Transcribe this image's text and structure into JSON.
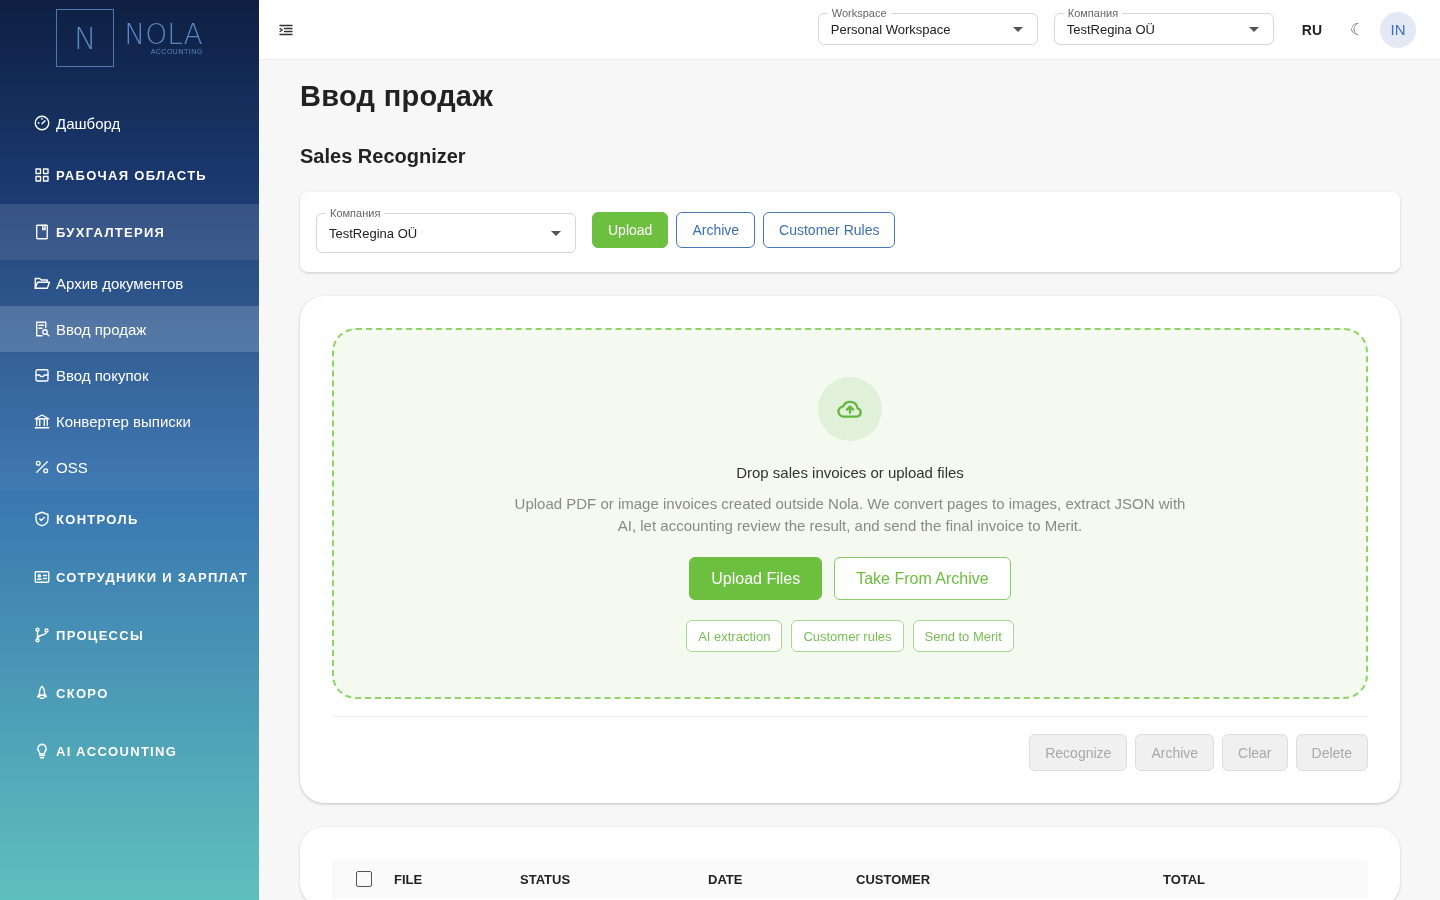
{
  "sidebar": {
    "logo": {
      "mark": "N",
      "name": "NOLA",
      "tagline": "ACCOUNTING"
    },
    "items": [
      {
        "kind": "link",
        "label": "Дашборд",
        "selected": false
      },
      {
        "kind": "section",
        "label": "РАБОЧАЯ ОБЛАСТЬ",
        "expanded": false
      },
      {
        "kind": "section",
        "label": "БУХГАЛТЕРИЯ",
        "expanded": true,
        "children": [
          {
            "label": "Архив документов",
            "selected": false
          },
          {
            "label": "Ввод продаж",
            "selected": true
          },
          {
            "label": "Ввод покупок",
            "selected": false
          },
          {
            "label": "Конвертер выписки",
            "selected": false
          },
          {
            "label": "OSS",
            "selected": false
          }
        ]
      },
      {
        "kind": "section",
        "label": "КОНТРОЛЬ",
        "expanded": false
      },
      {
        "kind": "section",
        "label": "СОТРУДНИКИ И ЗАРПЛАТ",
        "expanded": false
      },
      {
        "kind": "section",
        "label": "ПРОЦЕССЫ",
        "expanded": false
      },
      {
        "kind": "section",
        "label": "СКОРО",
        "expanded": false
      },
      {
        "kind": "section",
        "label": "AI ACCOUNTING",
        "expanded": false
      }
    ]
  },
  "topbar": {
    "workspace": {
      "label": "Workspace",
      "value": "Personal Workspace"
    },
    "company": {
      "label": "Компания",
      "value": "TestRegina OÜ"
    },
    "language": "RU",
    "theme_toggle": "☾",
    "avatar": "IN"
  },
  "page": {
    "title": "Ввод продаж",
    "subtitle": "Sales Recognizer",
    "toolbar": {
      "company": {
        "label": "Компания",
        "value": "TestRegina OÜ"
      },
      "buttons": [
        {
          "label": "Upload",
          "kind": "primary"
        },
        {
          "label": "Archive",
          "kind": "outline"
        },
        {
          "label": "Customer Rules",
          "kind": "outline"
        }
      ]
    },
    "dropzone": {
      "heading": "Drop sales invoices or upload files",
      "description": "Upload PDF or image invoices created outside Nola. We convert pages to images, extract JSON with AI, let accounting review the result, and send the final invoice to Merit.",
      "actions": [
        {
          "label": "Upload Files",
          "kind": "primary"
        },
        {
          "label": "Take From Archive",
          "kind": "outline"
        }
      ],
      "features": [
        "AI extraction",
        "Customer rules",
        "Send to Merit"
      ]
    },
    "bulk_actions": [
      {
        "label": "Recognize",
        "disabled": true
      },
      {
        "label": "Archive",
        "disabled": true
      },
      {
        "label": "Clear",
        "disabled": true
      },
      {
        "label": "Delete",
        "disabled": true
      }
    ],
    "table": {
      "select_all": {
        "checked": false
      },
      "columns": [
        "FILE",
        "STATUS",
        "DATE",
        "CUSTOMER",
        "TOTAL"
      ]
    }
  }
}
